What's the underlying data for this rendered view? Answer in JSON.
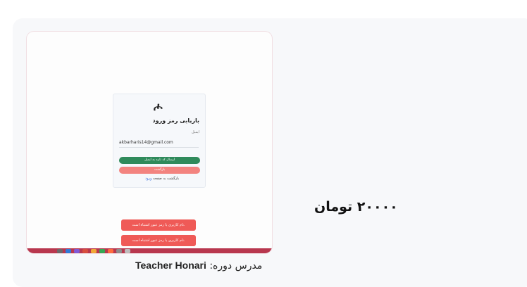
{
  "thumbnail": {
    "logo": "ሖ",
    "title": "بازیابی رمز ورود",
    "email_label": "ایمیل",
    "email_value": "akbarharis14@gmail.com",
    "send_button": "ارسال کد تایید به ایمیل",
    "back_button": "بازگشت",
    "back_text": "بازگشت به صفحه",
    "back_link": "ورود",
    "toasts": [
      "نام کاربری یا رمز عبور اشتباه است.",
      "نام کاربری یا رمز عبور اشتباه است."
    ]
  },
  "course": {
    "price": "۲۰۰۰۰ تومان",
    "teacher_label": "مدرس دوره:",
    "teacher_name": "Teacher Honari"
  },
  "colors": {
    "green": "#2f8a5b",
    "red": "#ef5a57",
    "taskbar": "#b8374e"
  }
}
